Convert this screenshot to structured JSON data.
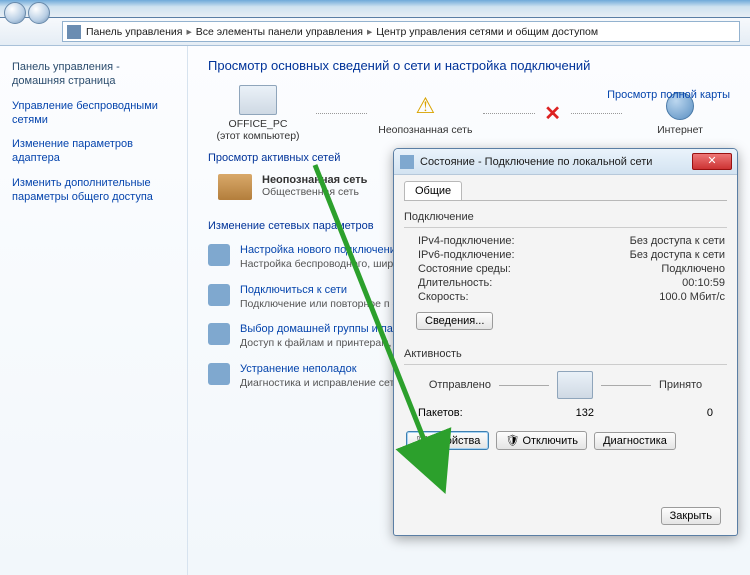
{
  "breadcrumb": {
    "items": [
      "Панель управления",
      "Все элементы панели управления",
      "Центр управления сетями и общим доступом"
    ]
  },
  "sidebar": {
    "title": "Панель управления - домашняя страница",
    "links": [
      "Управление беспроводными сетями",
      "Изменение параметров адаптера",
      "Изменить дополнительные параметры общего доступа"
    ]
  },
  "content": {
    "title": "Просмотр основных сведений о сети и настройка подключений",
    "map_link": "Просмотр полной карты",
    "nodes": {
      "pc": "OFFICE_PC",
      "pc_sub": "(этот компьютер)",
      "unknown": "Неопознанная сеть",
      "internet": "Интернет"
    },
    "active_label": "Просмотр активных сетей",
    "active_net": {
      "title": "Неопознанная сеть",
      "sub": "Общественная сеть"
    },
    "settings_label": "Изменение сетевых параметров",
    "settings": [
      {
        "title": "Настройка нового подключени",
        "desc": "Настройка беспроводного, шир или же настройка маршрутиз"
      },
      {
        "title": "Подключиться к сети",
        "desc": "Подключение или повторное п сетевому соединению или подк"
      },
      {
        "title": "Выбор домашней группы и пар",
        "desc": "Доступ к файлам и принтерам, изменение параметров общего"
      },
      {
        "title": "Устранение неполадок",
        "desc": "Диагностика и исправление сет"
      }
    ]
  },
  "dialog": {
    "title": "Состояние - Подключение по локальной сети",
    "tab": "Общие",
    "group_conn": "Подключение",
    "rows": [
      {
        "k": "IPv4-подключение:",
        "v": "Без доступа к сети"
      },
      {
        "k": "IPv6-подключение:",
        "v": "Без доступа к сети"
      },
      {
        "k": "Состояние среды:",
        "v": "Подключено"
      },
      {
        "k": "Длительность:",
        "v": "00:10:59"
      },
      {
        "k": "Скорость:",
        "v": "100.0 Мбит/с"
      }
    ],
    "details_btn": "Сведения...",
    "group_act": "Активность",
    "sent_label": "Отправлено",
    "recv_label": "Принято",
    "packets_label": "Пакетов:",
    "sent": "132",
    "recv": "0",
    "btn_props": "Свойства",
    "btn_disable": "Отключить",
    "btn_diag": "Диагностика",
    "btn_close": "Закрыть"
  }
}
